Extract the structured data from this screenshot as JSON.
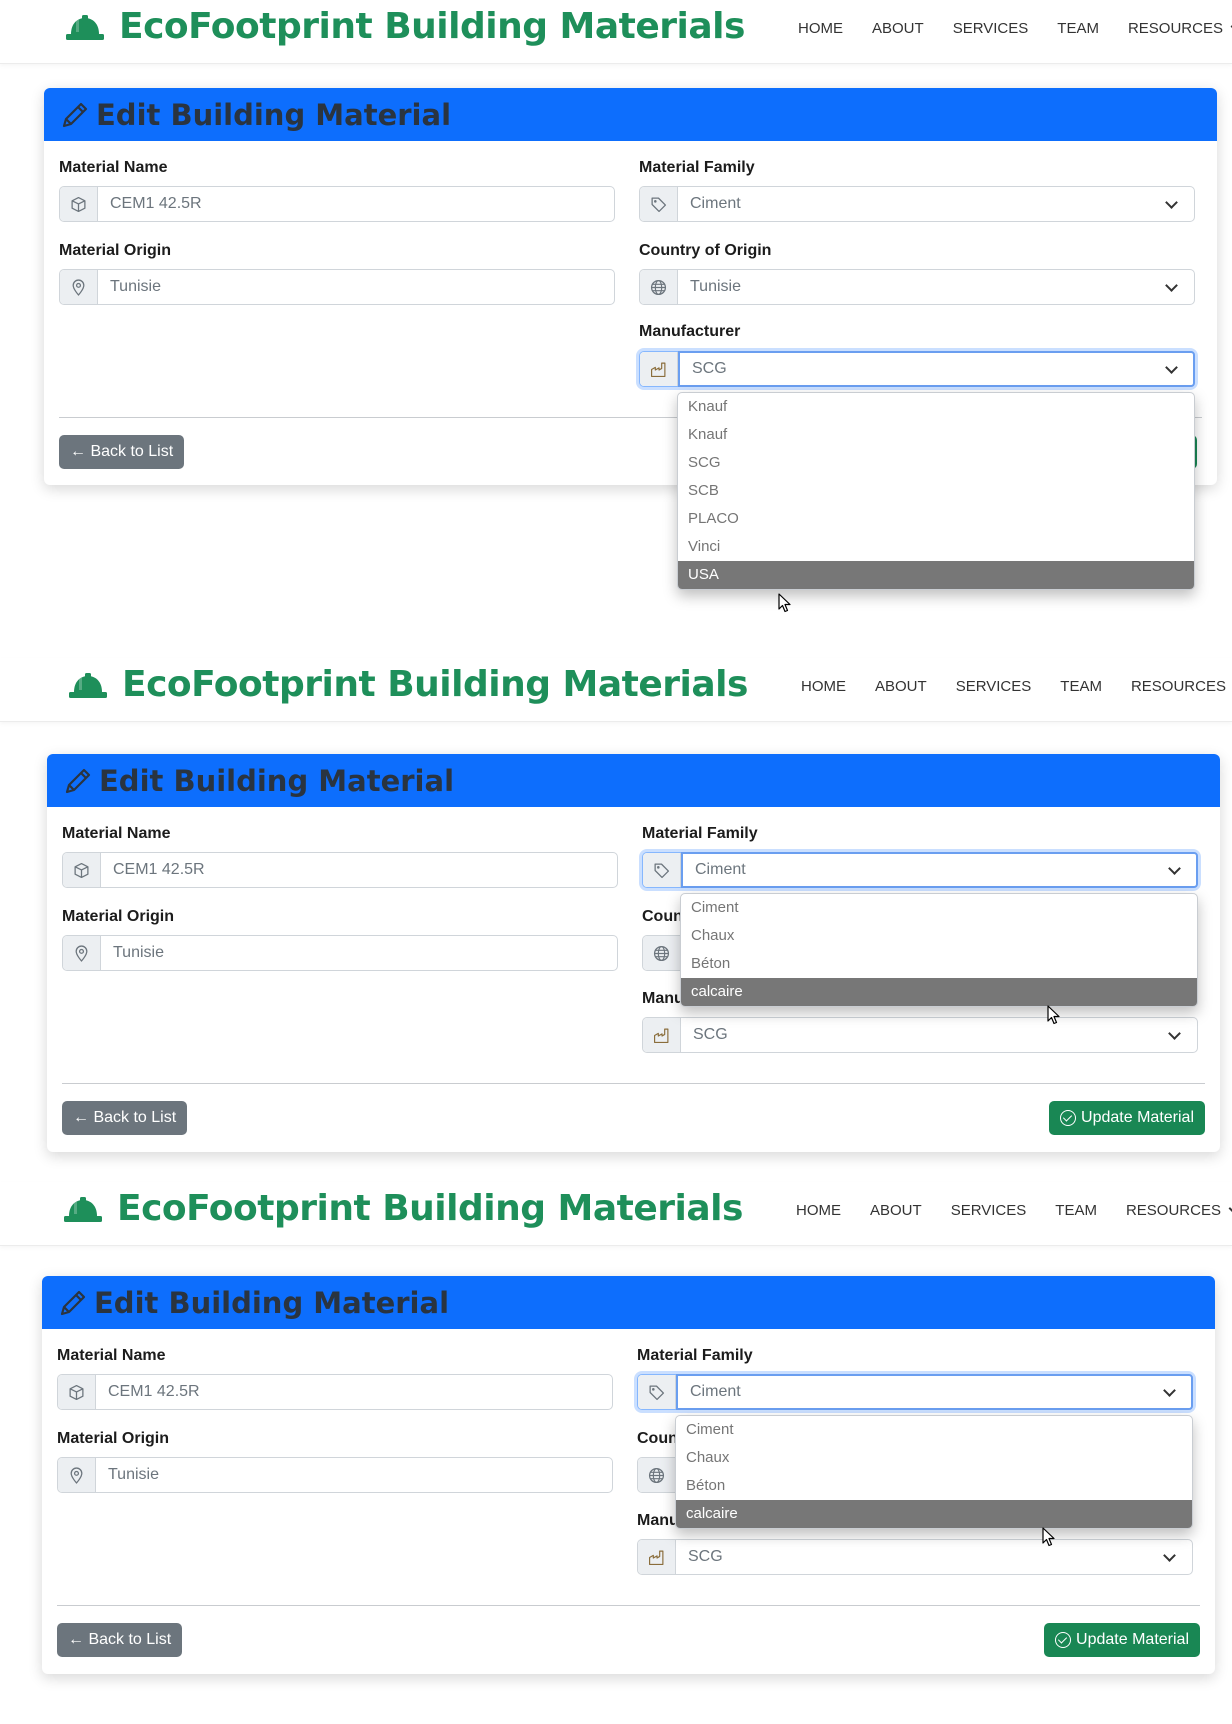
{
  "brand": {
    "title": "EcoFootprint Building Materials",
    "icon": "hard-hat-icon",
    "color": "#1e8f5a"
  },
  "nav": {
    "home": "HOME",
    "about": "ABOUT",
    "services": "SERVICES",
    "team": "TEAM",
    "resources": "RESOURCES"
  },
  "card": {
    "title": "Edit Building Material",
    "header_color": "#0d6efd"
  },
  "fields": {
    "material_name": {
      "label": "Material Name",
      "value": "CEM1 42.5R",
      "icon": "cube-icon"
    },
    "material_family": {
      "label": "Material Family",
      "value": "Ciment",
      "icon": "tag-icon"
    },
    "material_origin": {
      "label": "Material Origin",
      "value": "Tunisie",
      "icon": "map-pin-icon"
    },
    "country_of_origin": {
      "label": "Country of Origin",
      "label_truncated": "Coun",
      "value": "Tunisie",
      "icon": "globe-icon"
    },
    "manufacturer": {
      "label": "Manufacturer",
      "label_truncated": "Manu",
      "value": "SCG",
      "icon": "factory-icon"
    }
  },
  "buttons": {
    "back": "← Back to List",
    "update": "Update Material",
    "update_color": "#198754"
  },
  "manufacturer_options": [
    "Knauf",
    "Knauf",
    "SCG",
    "SCB",
    "PLACO",
    "Vinci",
    "USA"
  ],
  "manufacturer_highlighted": "USA",
  "family_options": [
    "Ciment",
    "Chaux",
    "Béton",
    "calcaire"
  ],
  "family_highlighted": "calcaire"
}
